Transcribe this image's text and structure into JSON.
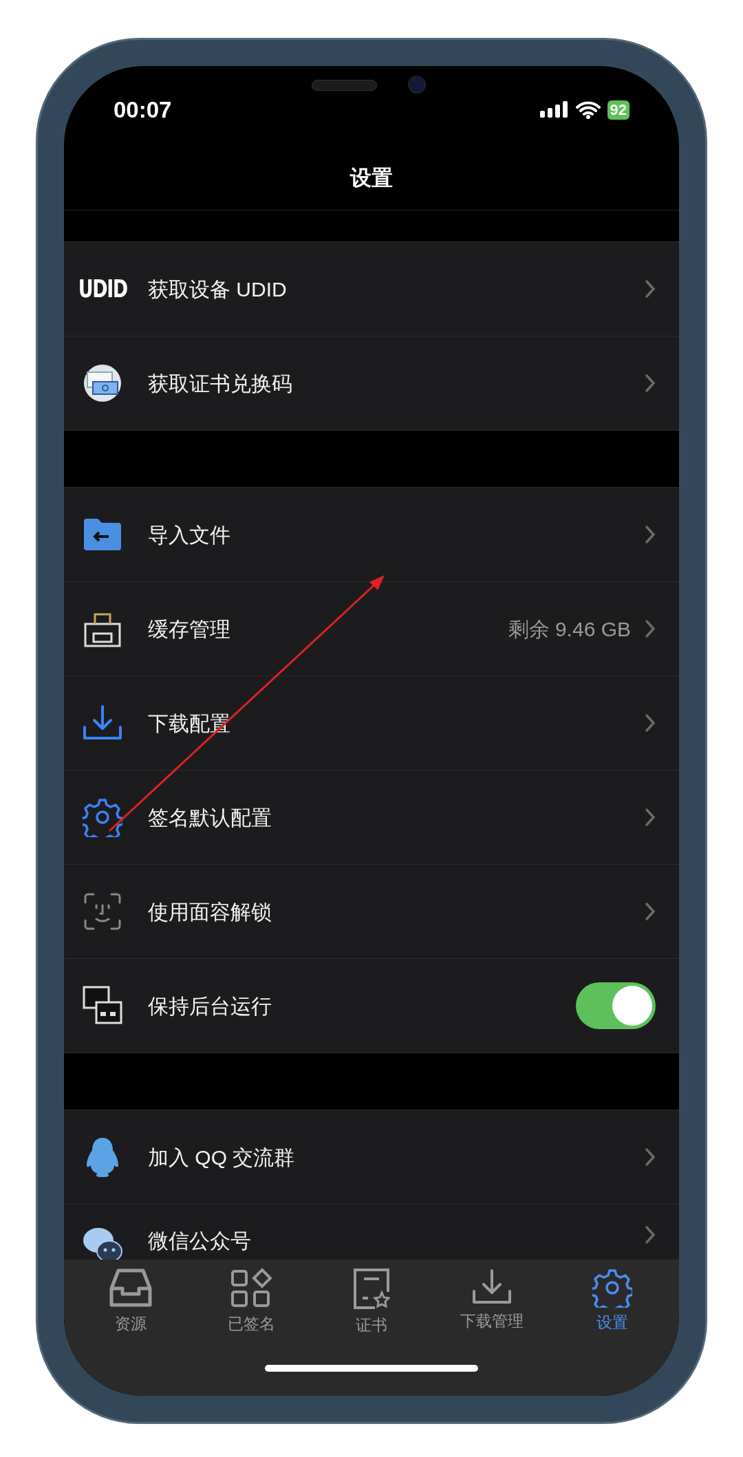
{
  "status_bar": {
    "time": "00:07",
    "battery": "92"
  },
  "title": "设置",
  "groups": [
    {
      "rows": [
        {
          "icon_text": "UDID",
          "label": "获取设备 UDID",
          "kind": "chevron"
        },
        {
          "label": "获取证书兑换码",
          "kind": "chevron"
        }
      ]
    },
    {
      "rows": [
        {
          "label": "导入文件",
          "kind": "chevron"
        },
        {
          "label": "缓存管理",
          "value": "剩余 9.46 GB",
          "kind": "chevron"
        },
        {
          "label": "下载配置",
          "kind": "chevron"
        },
        {
          "label": "签名默认配置",
          "kind": "chevron"
        },
        {
          "label": "使用面容解锁",
          "kind": "chevron"
        },
        {
          "label": "保持后台运行",
          "kind": "toggle",
          "on": true
        }
      ]
    },
    {
      "rows": [
        {
          "label": "加入 QQ 交流群",
          "kind": "chevron"
        },
        {
          "label": "微信公众号",
          "kind": "chevron"
        }
      ]
    }
  ],
  "tabs": [
    {
      "label": "资源",
      "selected": false
    },
    {
      "label": "已签名",
      "selected": false
    },
    {
      "label": "证书",
      "selected": false
    },
    {
      "label": "下载管理",
      "selected": false
    },
    {
      "label": "设置",
      "selected": true
    }
  ]
}
